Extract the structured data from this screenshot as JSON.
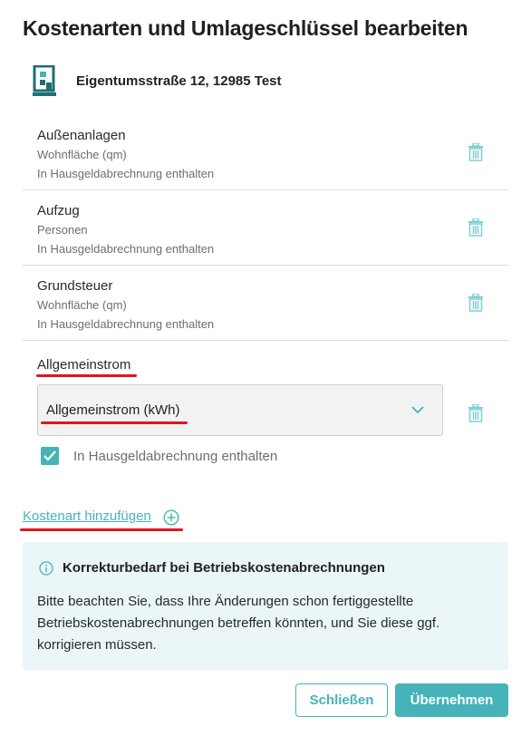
{
  "dialog": {
    "title": "Kostenarten und Umlageschlüssel bearbeiten",
    "property_address": "Eigentumsstraße 12, 12985 Test"
  },
  "cost_types": [
    {
      "name": "Außenanlagen",
      "key": "Wohnfläche (qm)",
      "included": "In Hausgeldabrechnung enthalten"
    },
    {
      "name": "Aufzug",
      "key": "Personen",
      "included": "In Hausgeldabrechnung enthalten"
    },
    {
      "name": "Grundsteuer",
      "key": "Wohnfläche (qm)",
      "included": "In Hausgeldabrechnung enthalten"
    }
  ],
  "editing": {
    "name": "Allgemeinstrom",
    "selected_key": "Allgemeinstrom (kWh)",
    "checkbox_label": "In Hausgeldabrechnung enthalten",
    "checkbox_checked": true
  },
  "add_link": "Kostenart hinzufügen",
  "info_box": {
    "title": "Korrekturbedarf bei Betriebskostenabrechnungen",
    "text": "Bitte beachten Sie, dass Ihre Änderungen schon fertiggestellte Betriebskostenabrechnungen betreffen könnten, und Sie diese ggf. korrigieren müssen."
  },
  "buttons": {
    "close": "Schließen",
    "apply": "Übernehmen"
  },
  "colors": {
    "accent": "#45b3b8",
    "annotation_red": "#e0141e",
    "info_bg": "#eaf6f7",
    "building_icon": "#1f6f73"
  },
  "icons": [
    "building-icon",
    "trash-icon",
    "chevron-down-icon",
    "checkmark-icon",
    "plus-circle-icon",
    "info-icon"
  ]
}
